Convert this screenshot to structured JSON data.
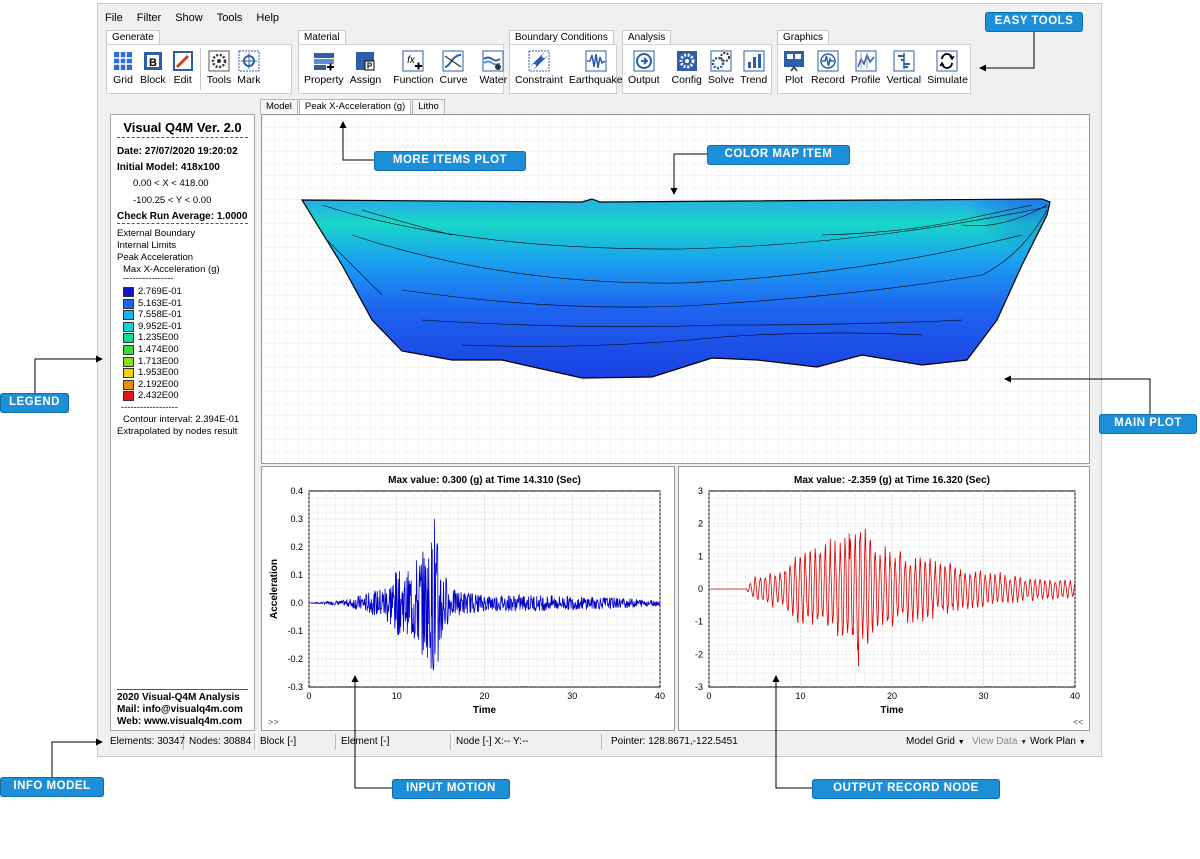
{
  "menu": [
    "File",
    "Filter",
    "Show",
    "Tools",
    "Help"
  ],
  "ribbon": {
    "generate": {
      "title": "Generate",
      "buttons": [
        "Grid",
        "Block",
        "Edit",
        "Tools",
        "Mark"
      ]
    },
    "material": {
      "title": "Material",
      "buttons": [
        "Property",
        "Assign",
        "Function",
        "Curve",
        "Water"
      ]
    },
    "boundary": {
      "title": "Boundary Conditions",
      "buttons": [
        "Constraint",
        "Earthquake"
      ]
    },
    "analysis": {
      "title": "Analysis",
      "buttons": [
        "Output",
        "Config",
        "Solve",
        "Trend"
      ]
    },
    "graphics": {
      "title": "Graphics",
      "buttons": [
        "Plot",
        "Record",
        "Profile",
        "Vertical",
        "Simulate"
      ]
    }
  },
  "plot_tabs": [
    "Model",
    "Peak X-Acceleration (g)",
    "Litho"
  ],
  "info": {
    "title": "Visual Q4M Ver. 2.0",
    "date": "Date: 27/07/2020 19:20:02",
    "initial_model": "Initial Model: 418x100",
    "x_range": "0.00 < X < 418.00",
    "y_range": "-100.25 < Y < 0.00",
    "check_run": "Check Run Average: 1.0000",
    "layers": [
      "External Boundary",
      "Internal Limits",
      "Peak Acceleration"
    ],
    "legend_title": "Max X-Acceleration (g)",
    "dashes": "----------------",
    "dashes2": "------------------",
    "legend": [
      {
        "label": "2.769E-01",
        "color": "#1414c8"
      },
      {
        "label": "5.163E-01",
        "color": "#1e64f0"
      },
      {
        "label": "7.558E-01",
        "color": "#10b4f0"
      },
      {
        "label": "9.952E-01",
        "color": "#10d2d2"
      },
      {
        "label": "1.235E00",
        "color": "#10d896"
      },
      {
        "label": "1.474E00",
        "color": "#3cd83c"
      },
      {
        "label": "1.713E00",
        "color": "#8cdc14"
      },
      {
        "label": "1.953E00",
        "color": "#f0d200"
      },
      {
        "label": "2.192E00",
        "color": "#f08c00"
      },
      {
        "label": "2.432E00",
        "color": "#e61414"
      }
    ],
    "contour": "Contour interval: 2.394E-01",
    "extrapolated": "Extrapolated by nodes result",
    "footer1": "2020 Visual-Q4M Analysis",
    "footer2": "Mail: info@visualq4m.com",
    "footer3": "Web: www.visualq4m.com"
  },
  "input_plot": {
    "title": "Max value: 0.300 (g) at Time 14.310 (Sec)",
    "xlabel": "Time",
    "ylabel": "Acceleration",
    "nav": ">>"
  },
  "output_plot": {
    "title": "Max value: -2.359 (g) at Time 16.320 (Sec)",
    "xlabel": "Time",
    "ylabel": "Acceleration",
    "nav": "<<"
  },
  "chart_data": [
    {
      "type": "line",
      "title": "Max value: 0.300 (g) at Time 14.310 (Sec)",
      "xlabel": "Time",
      "ylabel": "Acceleration",
      "xlim": [
        0,
        40
      ],
      "ylim": [
        -0.3,
        0.4
      ],
      "xticks": [
        "0",
        "10",
        "20",
        "30",
        "40"
      ],
      "yticks": [
        "0.4",
        "0.3",
        "0.2",
        "0.1",
        "0.0",
        "-0.1",
        "-0.2",
        "-0.3"
      ],
      "grid": true,
      "series": [
        {
          "color": "#0000cc",
          "max": 0.3,
          "t_max": 14.31,
          "x": [
            0,
            4,
            6,
            8,
            9,
            10,
            11,
            12,
            13,
            13.7,
            14.0,
            14.31,
            14.7,
            15,
            16,
            18,
            20,
            25,
            30,
            35,
            40
          ],
          "y": [
            0,
            0.01,
            0.03,
            0.05,
            0.08,
            -0.12,
            0.1,
            0.16,
            0.19,
            -0.2,
            0.25,
            0.3,
            -0.21,
            0.18,
            0.05,
            0.04,
            0.03,
            0.03,
            0.025,
            0.02,
            0.01
          ]
        }
      ]
    },
    {
      "type": "line",
      "title": "Max value: -2.359 (g) at Time 16.320 (Sec)",
      "xlabel": "Time",
      "ylabel": "Acceleration",
      "xlim": [
        0,
        40
      ],
      "ylim": [
        -3,
        3
      ],
      "xticks": [
        "0",
        "10",
        "20",
        "30",
        "40"
      ],
      "yticks": [
        "3",
        "2",
        "1",
        "0",
        "-1",
        "-2",
        "-3"
      ],
      "grid": true,
      "series": [
        {
          "color": "#dd0000",
          "min": -2.359,
          "t_min": 16.32,
          "x": [
            0,
            4,
            5,
            7,
            10,
            13,
            15,
            16.32,
            18,
            20,
            25,
            30,
            35,
            40
          ],
          "y": [
            0,
            0.0,
            0.4,
            0.6,
            1.2,
            1.6,
            1.7,
            -2.359,
            1.5,
            1.3,
            0.9,
            0.6,
            0.4,
            0.3
          ]
        }
      ]
    }
  ],
  "status": {
    "elements": "Elements: 30347",
    "nodes": "Nodes: 30884",
    "block": "Block [-]",
    "element": "Element [-]",
    "node": "Node [-]  X:-- Y:--",
    "pointer": "Pointer: 128.8671,-122.5451",
    "model_grid": "Model Grid",
    "view_data": "View Data",
    "work_plan": "Work Plan"
  },
  "callouts": {
    "easy_tools": "EASY TOOLS",
    "more_items": "MORE ITEMS PLOT",
    "color_map": "COLOR MAP ITEM",
    "legend": "LEGEND",
    "main_plot": "MAIN PLOT",
    "info_model": "INFO MODEL",
    "input_motion": "INPUT MOTION",
    "output_record": "OUTPUT RECORD NODE"
  }
}
